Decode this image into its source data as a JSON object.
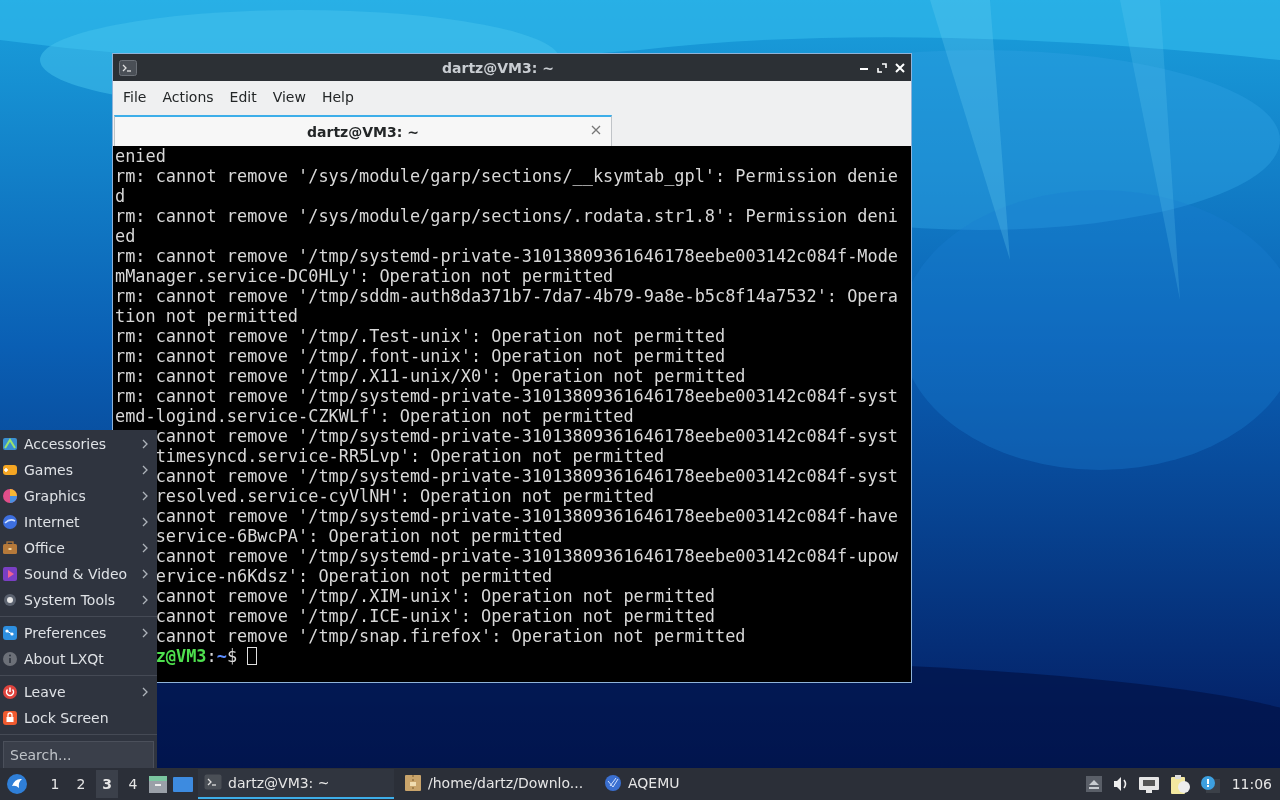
{
  "terminal_window": {
    "title": "dartz@VM3: ~",
    "menus": [
      "File",
      "Actions",
      "Edit",
      "View",
      "Help"
    ],
    "tabs": [
      {
        "label": "dartz@VM3: ~",
        "selected": true
      }
    ],
    "lines": [
      {
        "text": "enied",
        "covered": false
      },
      {
        "text": "rm: cannot remove '/sys/module/garp/sections/__ksymtab_gpl': Permission denie",
        "covered": false
      },
      {
        "text": "d",
        "covered": false
      },
      {
        "text": "rm: cannot remove '/sys/module/garp/sections/.rodata.str1.8': Permission deni",
        "covered": false
      },
      {
        "text": "ed",
        "covered": false
      },
      {
        "text": "rm: cannot remove '/tmp/systemd-private-31013809361646178eebe003142c084f-Mode",
        "covered": false
      },
      {
        "text": "mManager.service-DC0HLy': Operation not permitted",
        "covered": false
      },
      {
        "text": "rm: cannot remove '/tmp/sddm-auth8da371b7-7da7-4b79-9a8e-b5c8f14a7532': Opera",
        "covered": false
      },
      {
        "text": "tion not permitted",
        "covered": false
      },
      {
        "text": "rm: cannot remove '/tmp/.Test-unix': Operation not permitted",
        "covered": false
      },
      {
        "text": "rm: cannot remove '/tmp/.font-unix': Operation not permitted",
        "covered": false
      },
      {
        "text": "rm: cannot remove '/tmp/.X11-unix/X0': Operation not permitted",
        "covered": false
      },
      {
        "text": "rm: cannot remove '/tmp/systemd-private-31013809361646178eebe003142c084f-syst",
        "covered": false
      },
      {
        "text": "emd-logind.service-CZKWLf': Operation not permitted",
        "covered": false
      },
      {
        "text": "cannot remove '/tmp/systemd-private-31013809361646178eebe003142c084f-syst",
        "covered": true
      },
      {
        "text": "timesyncd.service-RR5Lvp': Operation not permitted",
        "covered": true
      },
      {
        "text": "cannot remove '/tmp/systemd-private-31013809361646178eebe003142c084f-syst",
        "covered": true
      },
      {
        "text": "resolved.service-cyVlNH': Operation not permitted",
        "covered": true
      },
      {
        "text": "cannot remove '/tmp/systemd-private-31013809361646178eebe003142c084f-have",
        "covered": true
      },
      {
        "text": "service-6BwcPA': Operation not permitted",
        "covered": true
      },
      {
        "text": "cannot remove '/tmp/systemd-private-31013809361646178eebe003142c084f-upow",
        "covered": true
      },
      {
        "text": "ervice-n6Kdsz': Operation not permitted",
        "covered": true
      },
      {
        "text": "cannot remove '/tmp/.XIM-unix': Operation not permitted",
        "covered": true
      },
      {
        "text": "cannot remove '/tmp/.ICE-unix': Operation not permitted",
        "covered": true
      },
      {
        "text": "cannot remove '/tmp/snap.firefox': Operation not permitted",
        "covered": true
      }
    ],
    "prompt": {
      "user_host": "z@VM3",
      "separator": ":",
      "path": "~",
      "symbol": "$",
      "covered": true
    }
  },
  "app_menu": {
    "sections": [
      [
        {
          "label": "Accessories",
          "submenu": true
        },
        {
          "label": "Games",
          "submenu": true
        },
        {
          "label": "Graphics",
          "submenu": true
        },
        {
          "label": "Internet",
          "submenu": true
        },
        {
          "label": "Office",
          "submenu": true
        },
        {
          "label": "Sound & Video",
          "submenu": true
        },
        {
          "label": "System Tools",
          "submenu": true
        }
      ],
      [
        {
          "label": "Preferences",
          "submenu": true
        },
        {
          "label": "About LXQt",
          "submenu": false
        }
      ],
      [
        {
          "label": "Leave",
          "submenu": true
        },
        {
          "label": "Lock Screen",
          "submenu": false
        }
      ]
    ],
    "search": {
      "placeholder": "Search..."
    }
  },
  "taskbar": {
    "workspaces": [
      {
        "label": "1",
        "selected": false
      },
      {
        "label": "2",
        "selected": false
      },
      {
        "label": "3",
        "selected": true
      },
      {
        "label": "4",
        "selected": false
      }
    ],
    "tasks": [
      {
        "label": "dartz@VM3: ~",
        "selected": true
      },
      {
        "label": "/home/dartz/Downlo...",
        "selected": false
      },
      {
        "label": "AQEMU",
        "selected": false
      }
    ],
    "clock": "11:06"
  }
}
